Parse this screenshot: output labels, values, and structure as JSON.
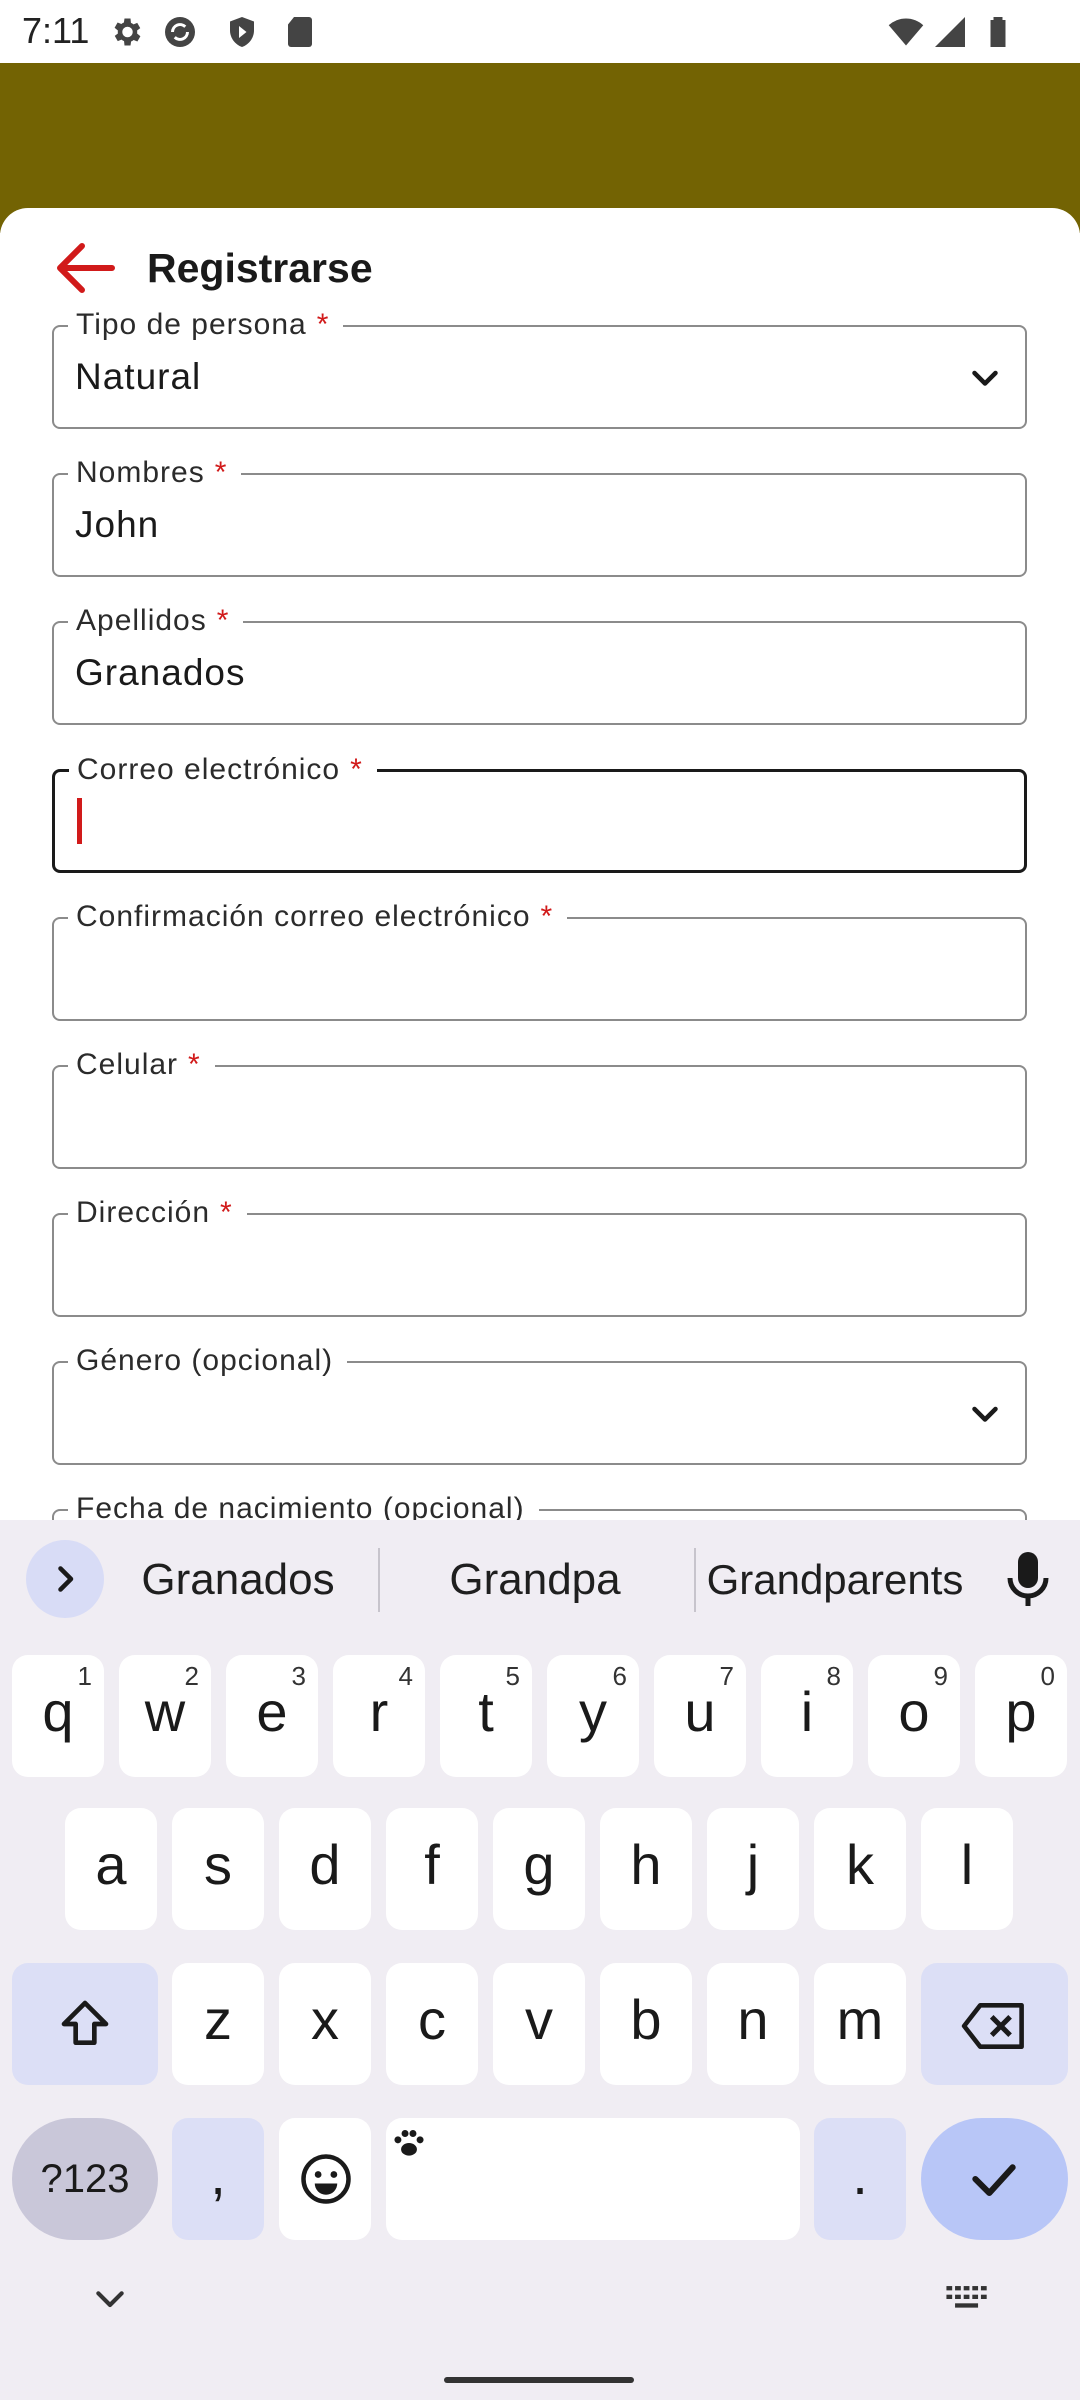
{
  "status_bar": {
    "time": "7:11",
    "left_icons": [
      "gear-icon",
      "sync-icon",
      "shield-play-icon",
      "sd-card-icon"
    ],
    "right_icons": [
      "wifi-icon",
      "cell-signal-icon",
      "battery-icon"
    ]
  },
  "header": {
    "color": "#736303"
  },
  "form": {
    "title": "Registrarse",
    "back_icon": "arrow-left-icon",
    "accent": "#d11a1a",
    "required_mark": "*",
    "fields": [
      {
        "label": "Tipo de persona",
        "required": true,
        "value": "Natural",
        "type": "select"
      },
      {
        "label": "Nombres",
        "required": true,
        "value": "John",
        "type": "text"
      },
      {
        "label": "Apellidos",
        "required": true,
        "value": "Granados",
        "type": "text"
      },
      {
        "label": "Correo electrónico",
        "required": true,
        "value": "",
        "type": "text",
        "focused": true
      },
      {
        "label": "Confirmación correo electrónico",
        "required": true,
        "value": "",
        "type": "text"
      },
      {
        "label": "Celular",
        "required": true,
        "value": "",
        "type": "text"
      },
      {
        "label": "Dirección",
        "required": true,
        "value": "",
        "type": "text"
      },
      {
        "label": "Género (opcional)",
        "required": false,
        "value": "",
        "type": "select"
      },
      {
        "label": "Fecha de nacimiento (opcional)",
        "required": false,
        "value": "",
        "type": "text"
      }
    ]
  },
  "keyboard": {
    "suggestions": [
      "Granados",
      "Grandpa",
      "Grandparents"
    ],
    "row1": [
      {
        "ch": "q",
        "hint": "1"
      },
      {
        "ch": "w",
        "hint": "2"
      },
      {
        "ch": "e",
        "hint": "3"
      },
      {
        "ch": "r",
        "hint": "4"
      },
      {
        "ch": "t",
        "hint": "5"
      },
      {
        "ch": "y",
        "hint": "6"
      },
      {
        "ch": "u",
        "hint": "7"
      },
      {
        "ch": "i",
        "hint": "8"
      },
      {
        "ch": "o",
        "hint": "9"
      },
      {
        "ch": "p",
        "hint": "0"
      }
    ],
    "row2": [
      "a",
      "s",
      "d",
      "f",
      "g",
      "h",
      "j",
      "k",
      "l"
    ],
    "row3": [
      "z",
      "x",
      "c",
      "v",
      "b",
      "n",
      "m"
    ],
    "symbols_label": "?123",
    "comma": ",",
    "period": "."
  }
}
